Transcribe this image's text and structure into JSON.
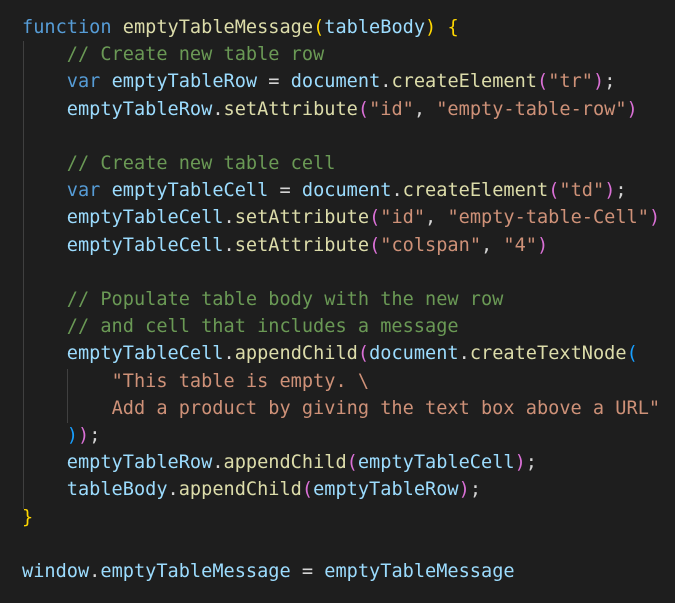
{
  "editor": {
    "theme": {
      "background": "#1e1e1e",
      "indent_guide": "#404040",
      "colors": {
        "keyword": "#569cd6",
        "function": "#dcdcaa",
        "variable": "#9cdcfe",
        "string": "#ce9178",
        "comment": "#6a9955",
        "plain": "#d4d4d4",
        "bracket1": "#ffd700",
        "bracket2": "#da70d6",
        "bracket3": "#179fff"
      }
    },
    "lines": [
      {
        "tokens": [
          {
            "t": "function",
            "c": "keyword"
          },
          {
            "t": " ",
            "c": "plain"
          },
          {
            "t": "emptyTableMessage",
            "c": "function"
          },
          {
            "t": "(",
            "c": "bracket1"
          },
          {
            "t": "tableBody",
            "c": "variable"
          },
          {
            "t": ")",
            "c": "bracket1"
          },
          {
            "t": " ",
            "c": "plain"
          },
          {
            "t": "{",
            "c": "bracket1"
          }
        ]
      },
      {
        "tokens": [
          {
            "t": "    ",
            "c": "plain"
          },
          {
            "t": "// Create new table row",
            "c": "comment"
          }
        ]
      },
      {
        "tokens": [
          {
            "t": "    ",
            "c": "plain"
          },
          {
            "t": "var",
            "c": "keyword"
          },
          {
            "t": " ",
            "c": "plain"
          },
          {
            "t": "emptyTableRow",
            "c": "variable"
          },
          {
            "t": " = ",
            "c": "plain"
          },
          {
            "t": "document",
            "c": "variable"
          },
          {
            "t": ".",
            "c": "plain"
          },
          {
            "t": "createElement",
            "c": "function"
          },
          {
            "t": "(",
            "c": "bracket2"
          },
          {
            "t": "\"tr\"",
            "c": "string"
          },
          {
            "t": ")",
            "c": "bracket2"
          },
          {
            "t": ";",
            "c": "plain"
          }
        ]
      },
      {
        "tokens": [
          {
            "t": "    ",
            "c": "plain"
          },
          {
            "t": "emptyTableRow",
            "c": "variable"
          },
          {
            "t": ".",
            "c": "plain"
          },
          {
            "t": "setAttribute",
            "c": "function"
          },
          {
            "t": "(",
            "c": "bracket2"
          },
          {
            "t": "\"id\"",
            "c": "string"
          },
          {
            "t": ", ",
            "c": "plain"
          },
          {
            "t": "\"empty-table-row\"",
            "c": "string"
          },
          {
            "t": ")",
            "c": "bracket2"
          }
        ]
      },
      {
        "tokens": []
      },
      {
        "tokens": [
          {
            "t": "    ",
            "c": "plain"
          },
          {
            "t": "// Create new table cell",
            "c": "comment"
          }
        ]
      },
      {
        "tokens": [
          {
            "t": "    ",
            "c": "plain"
          },
          {
            "t": "var",
            "c": "keyword"
          },
          {
            "t": " ",
            "c": "plain"
          },
          {
            "t": "emptyTableCell",
            "c": "variable"
          },
          {
            "t": " = ",
            "c": "plain"
          },
          {
            "t": "document",
            "c": "variable"
          },
          {
            "t": ".",
            "c": "plain"
          },
          {
            "t": "createElement",
            "c": "function"
          },
          {
            "t": "(",
            "c": "bracket2"
          },
          {
            "t": "\"td\"",
            "c": "string"
          },
          {
            "t": ")",
            "c": "bracket2"
          },
          {
            "t": ";",
            "c": "plain"
          }
        ]
      },
      {
        "tokens": [
          {
            "t": "    ",
            "c": "plain"
          },
          {
            "t": "emptyTableCell",
            "c": "variable"
          },
          {
            "t": ".",
            "c": "plain"
          },
          {
            "t": "setAttribute",
            "c": "function"
          },
          {
            "t": "(",
            "c": "bracket2"
          },
          {
            "t": "\"id\"",
            "c": "string"
          },
          {
            "t": ", ",
            "c": "plain"
          },
          {
            "t": "\"empty-table-Cell\"",
            "c": "string"
          },
          {
            "t": ")",
            "c": "bracket2"
          }
        ]
      },
      {
        "tokens": [
          {
            "t": "    ",
            "c": "plain"
          },
          {
            "t": "emptyTableCell",
            "c": "variable"
          },
          {
            "t": ".",
            "c": "plain"
          },
          {
            "t": "setAttribute",
            "c": "function"
          },
          {
            "t": "(",
            "c": "bracket2"
          },
          {
            "t": "\"colspan\"",
            "c": "string"
          },
          {
            "t": ", ",
            "c": "plain"
          },
          {
            "t": "\"4\"",
            "c": "string"
          },
          {
            "t": ")",
            "c": "bracket2"
          }
        ]
      },
      {
        "tokens": []
      },
      {
        "tokens": [
          {
            "t": "    ",
            "c": "plain"
          },
          {
            "t": "// Populate table body with the new row",
            "c": "comment"
          }
        ]
      },
      {
        "tokens": [
          {
            "t": "    ",
            "c": "plain"
          },
          {
            "t": "// and cell that includes a message",
            "c": "comment"
          }
        ]
      },
      {
        "tokens": [
          {
            "t": "    ",
            "c": "plain"
          },
          {
            "t": "emptyTableCell",
            "c": "variable"
          },
          {
            "t": ".",
            "c": "plain"
          },
          {
            "t": "appendChild",
            "c": "function"
          },
          {
            "t": "(",
            "c": "bracket2"
          },
          {
            "t": "document",
            "c": "variable"
          },
          {
            "t": ".",
            "c": "plain"
          },
          {
            "t": "createTextNode",
            "c": "function"
          },
          {
            "t": "(",
            "c": "bracket3"
          }
        ]
      },
      {
        "tokens": [
          {
            "t": "        ",
            "c": "plain"
          },
          {
            "t": "\"This table is empty. \\",
            "c": "string"
          }
        ]
      },
      {
        "tokens": [
          {
            "t": "        ",
            "c": "plain"
          },
          {
            "t": "Add a product by giving the text box above a URL\"",
            "c": "string"
          }
        ]
      },
      {
        "tokens": [
          {
            "t": "    ",
            "c": "plain"
          },
          {
            "t": ")",
            "c": "bracket3"
          },
          {
            "t": ")",
            "c": "bracket2"
          },
          {
            "t": ";",
            "c": "plain"
          }
        ]
      },
      {
        "tokens": [
          {
            "t": "    ",
            "c": "plain"
          },
          {
            "t": "emptyTableRow",
            "c": "variable"
          },
          {
            "t": ".",
            "c": "plain"
          },
          {
            "t": "appendChild",
            "c": "function"
          },
          {
            "t": "(",
            "c": "bracket2"
          },
          {
            "t": "emptyTableCell",
            "c": "variable"
          },
          {
            "t": ")",
            "c": "bracket2"
          },
          {
            "t": ";",
            "c": "plain"
          }
        ]
      },
      {
        "tokens": [
          {
            "t": "    ",
            "c": "plain"
          },
          {
            "t": "tableBody",
            "c": "variable"
          },
          {
            "t": ".",
            "c": "plain"
          },
          {
            "t": "appendChild",
            "c": "function"
          },
          {
            "t": "(",
            "c": "bracket2"
          },
          {
            "t": "emptyTableRow",
            "c": "variable"
          },
          {
            "t": ")",
            "c": "bracket2"
          },
          {
            "t": ";",
            "c": "plain"
          }
        ]
      },
      {
        "tokens": [
          {
            "t": "}",
            "c": "bracket1"
          }
        ]
      },
      {
        "tokens": []
      },
      {
        "tokens": [
          {
            "t": "window",
            "c": "variable"
          },
          {
            "t": ".",
            "c": "plain"
          },
          {
            "t": "emptyTableMessage",
            "c": "variable"
          },
          {
            "t": " = ",
            "c": "plain"
          },
          {
            "t": "emptyTableMessage",
            "c": "variable"
          }
        ]
      }
    ]
  }
}
